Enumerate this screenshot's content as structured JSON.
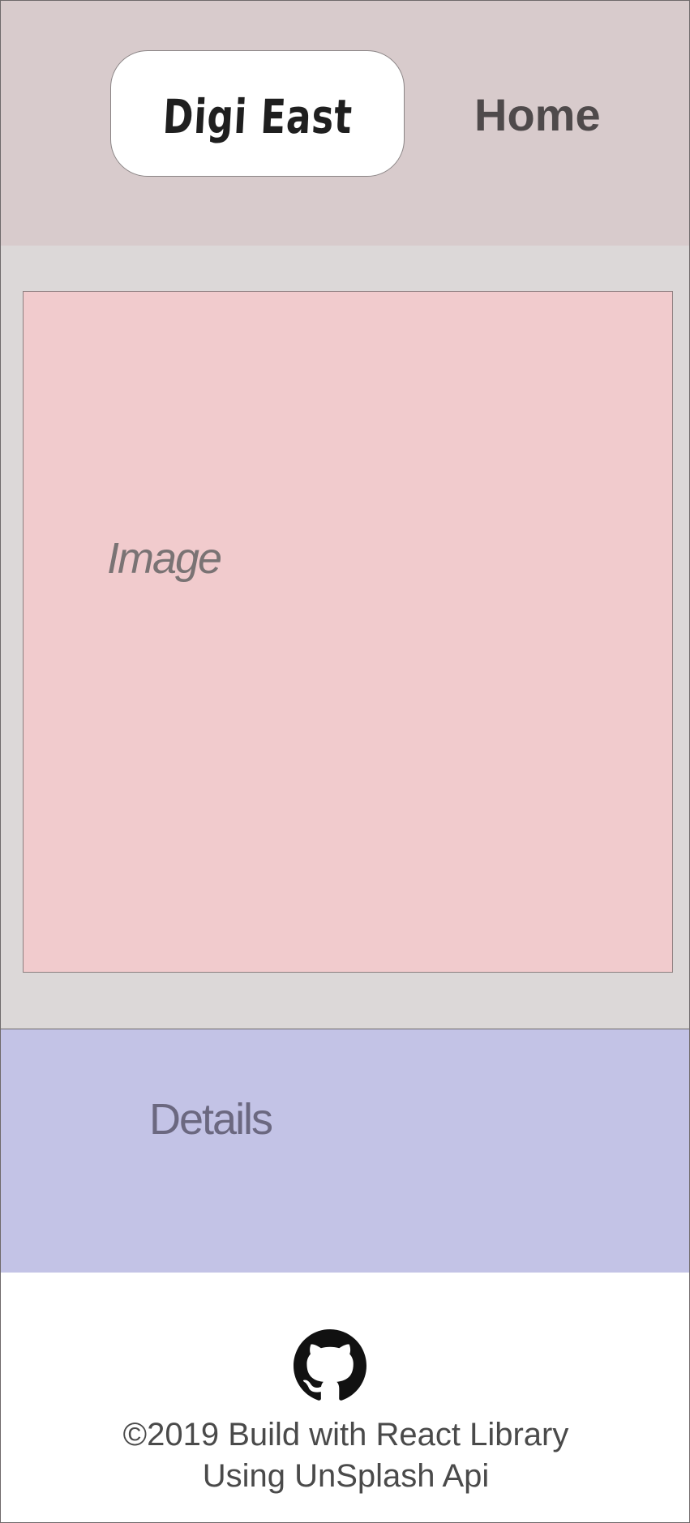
{
  "header": {
    "brand": "Digi East",
    "nav_home": "Home"
  },
  "main": {
    "image_placeholder": "Image",
    "details_placeholder": "Details"
  },
  "footer": {
    "icon": "github-icon",
    "line1": "©2019 Build with React Library",
    "line2": "Using UnSplash Api"
  },
  "colors": {
    "header_bg": "#d8cbcc",
    "image_section_bg": "#dcd8d8",
    "image_box_bg": "#f1cbcd",
    "details_bg": "#c3c3e6",
    "footer_bg": "#ffffff",
    "text_dark": "#4f4a4b"
  }
}
